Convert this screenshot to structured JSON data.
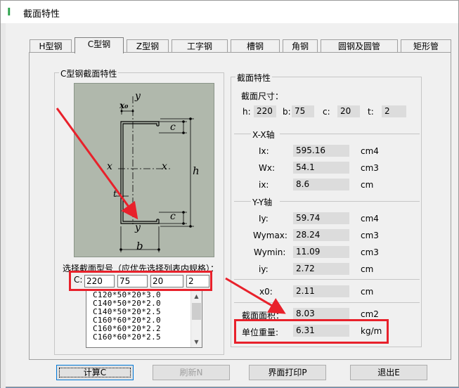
{
  "window": {
    "title": "截面特性"
  },
  "tabs": [
    {
      "label": "H型钢"
    },
    {
      "label": "C型钢"
    },
    {
      "label": "Z型钢"
    },
    {
      "label": "工字钢"
    },
    {
      "label": "槽钢"
    },
    {
      "label": "角钢"
    },
    {
      "label": "圆钢及圆管"
    },
    {
      "label": "矩形管"
    }
  ],
  "left_group": {
    "title": "C型钢截面特性",
    "diagram_labels": {
      "y_top": "y",
      "x0": "x₀",
      "c_top": "c",
      "x_left": "x",
      "x_right": "x",
      "h": "h",
      "t": "t",
      "c_bottom": "c",
      "y_bottom": "y",
      "b": "b"
    },
    "select_label": "选择截面型号（应优先选择列表内规格）：",
    "c_label": "C:",
    "inputs": {
      "h": "220",
      "b": "75",
      "c": "20",
      "t": "2"
    },
    "list_items": [
      "C120*50*20*3.0",
      "C140*50*20*2.0",
      "C140*50*20*2.5",
      "C160*60*20*2.0",
      "C160*60*20*2.2",
      "C160*60*20*2.5"
    ]
  },
  "props": {
    "title": "截面特性",
    "dims_label": "截面尺寸：",
    "dims": [
      {
        "label": "h:",
        "value": "220"
      },
      {
        "label": "b:",
        "value": "75"
      },
      {
        "label": "c:",
        "value": "20"
      },
      {
        "label": "t:",
        "value": "2"
      }
    ],
    "xx_title": "X-X轴",
    "xx": [
      {
        "label": "Ix:",
        "value": "595.16",
        "unit": "cm4"
      },
      {
        "label": "Wx:",
        "value": "54.1",
        "unit": "cm3"
      },
      {
        "label": "ix:",
        "value": "8.6",
        "unit": "cm"
      }
    ],
    "yy_title": "Y-Y轴",
    "yy": [
      {
        "label": "Iy:",
        "value": "59.74",
        "unit": "cm4"
      },
      {
        "label": "Wymax:",
        "value": "28.24",
        "unit": "cm3"
      },
      {
        "label": "Wymin:",
        "value": "11.09",
        "unit": "cm3"
      },
      {
        "label": "iy:",
        "value": "2.72",
        "unit": "cm"
      }
    ],
    "x0": {
      "label": "x0:",
      "value": "2.11",
      "unit": "cm"
    },
    "area": {
      "label": "截面面积：",
      "value": "8.03",
      "unit": "cm2"
    },
    "weight": {
      "label": "单位重量:",
      "value": "6.31",
      "unit": "kg/m"
    }
  },
  "buttons": {
    "calc": "计算C",
    "refresh": "刷新N",
    "print": "界面打印P",
    "exit": "退出E"
  },
  "colors": {
    "annotation_red": "#e8212b",
    "diagram_bg": "#b0b8ac"
  }
}
